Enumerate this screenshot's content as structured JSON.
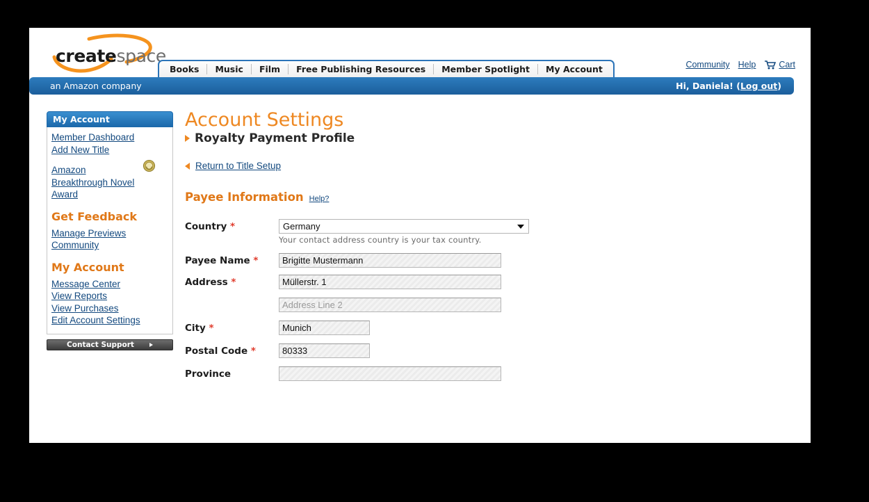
{
  "brand": {
    "logo_create": "create",
    "logo_space": "space",
    "tagline": "an Amazon company",
    "accent_orange": "#ee8822",
    "accent_blue": "#1c69ab",
    "link_blue": "#13497f"
  },
  "nav": {
    "items": [
      {
        "label": "Books"
      },
      {
        "label": "Music"
      },
      {
        "label": "Film"
      },
      {
        "label": "Free Publishing Resources"
      },
      {
        "label": "Member Spotlight"
      },
      {
        "label": "My Account"
      }
    ]
  },
  "utility": {
    "community": "Community",
    "help": "Help",
    "cart": "Cart",
    "cart_icon": "shopping-cart-icon"
  },
  "account_bar": {
    "greeting": "Hi, Daniela! (",
    "logout": "Log out",
    "greeting_close": ")"
  },
  "sidebar": {
    "header": "My Account",
    "group1": [
      {
        "label": "Member Dashboard"
      },
      {
        "label": "Add New Title"
      }
    ],
    "award": {
      "label": "Amazon Breakthrough Novel Award",
      "icon": "medal-icon"
    },
    "section_feedback": "Get Feedback",
    "group2": [
      {
        "label": "Manage Previews"
      },
      {
        "label": "Community"
      }
    ],
    "section_account": "My Account",
    "group3": [
      {
        "label": "Message Center"
      },
      {
        "label": "View Reports"
      },
      {
        "label": "View Purchases"
      },
      {
        "label": "Edit Account Settings"
      }
    ],
    "support_button": "Contact Support"
  },
  "main": {
    "title": "Account Settings",
    "subtitle": "Royalty Payment Profile",
    "back_link": "Return to Title Setup",
    "section_title": "Payee Information",
    "section_help": "Help?",
    "required_mark": "*",
    "fields": {
      "country": {
        "label": "Country",
        "required": true,
        "value": "Germany",
        "hint": "Your contact address country is your tax country."
      },
      "payee_name": {
        "label": "Payee Name",
        "required": true,
        "value": "Brigitte Mustermann",
        "placeholder": ""
      },
      "address": {
        "label": "Address",
        "required": true,
        "value": "Müllerstr. 1",
        "placeholder": ""
      },
      "address2": {
        "label": "",
        "required": false,
        "value": "",
        "placeholder": "Address Line 2"
      },
      "city": {
        "label": "City",
        "required": true,
        "value": "Munich",
        "placeholder": ""
      },
      "postal_code": {
        "label": "Postal Code",
        "required": true,
        "value": "80333",
        "placeholder": ""
      },
      "province": {
        "label": "Province",
        "required": false,
        "value": "",
        "placeholder": ""
      }
    }
  }
}
